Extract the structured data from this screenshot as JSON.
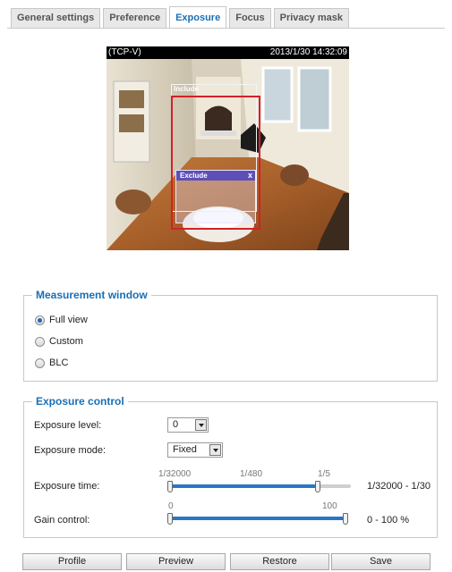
{
  "tabs": [
    {
      "label": "General settings",
      "active": false
    },
    {
      "label": "Preference",
      "active": false
    },
    {
      "label": "Exposure",
      "active": true
    },
    {
      "label": "Focus",
      "active": false
    },
    {
      "label": "Privacy mask",
      "active": false
    }
  ],
  "video": {
    "stream": "(TCP-V)",
    "timestamp": "2013/1/30 14:32:09",
    "include_label": "Include",
    "exclude_label": "Exclude",
    "exclude_close": "x"
  },
  "measurement": {
    "title": "Measurement window",
    "options": [
      "Full view",
      "Custom",
      "BLC"
    ],
    "selected": "Full view"
  },
  "exposure": {
    "title": "Exposure control",
    "level_label": "Exposure level:",
    "level_value": "0",
    "mode_label": "Exposure mode:",
    "mode_value": "Fixed",
    "time_label": "Exposure time:",
    "time_ticks": [
      "1/32000",
      "1/480",
      "1/5"
    ],
    "time_range": "1/32000 - 1/30",
    "gain_label": "Gain control:",
    "gain_ticks": [
      "0",
      "100"
    ],
    "gain_range": "0 - 100 %"
  },
  "buttons": {
    "profile": "Profile",
    "preview": "Preview",
    "restore": "Restore",
    "save": "Save"
  },
  "colors": {
    "accent": "#1a6fb5",
    "slider": "#2a76c6",
    "include_border": "#d4202a",
    "exclude_header": "#5d4fb7"
  }
}
